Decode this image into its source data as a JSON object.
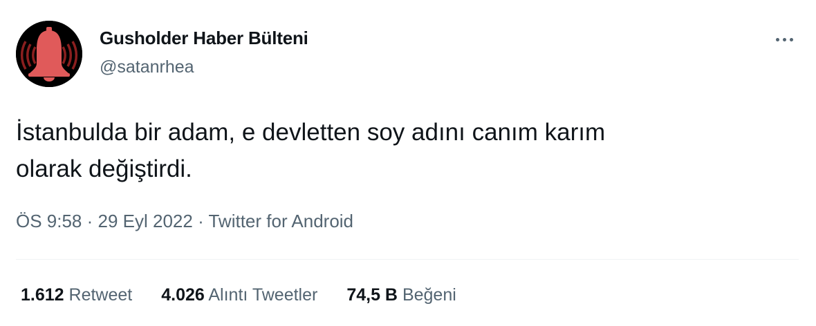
{
  "user": {
    "display_name": "Gusholder Haber Bülteni",
    "handle": "@satanrhea",
    "avatar_icon": "bell-icon",
    "avatar_colors": {
      "background": "#000000",
      "bell": "#e05a5a",
      "rings": "#8b1f1f"
    }
  },
  "menu": {
    "more_icon": "more-horizontal-icon"
  },
  "tweet": {
    "text": "İstanbulda bir adam, e devletten soy adını canım karım\nolarak değiştirdi.",
    "time": "ÖS 9:58",
    "separator": " · ",
    "date": "29 Eyl 2022",
    "source": "Twitter for Android"
  },
  "stats": [
    {
      "count": "1.612",
      "label": "Retweet"
    },
    {
      "count": "4.026",
      "label": "Alıntı Tweetler"
    },
    {
      "count": "74,5 B",
      "label": "Beğeni"
    }
  ],
  "colors": {
    "text_primary": "#0f1419",
    "text_secondary": "#536471",
    "divider": "#eff3f4"
  }
}
